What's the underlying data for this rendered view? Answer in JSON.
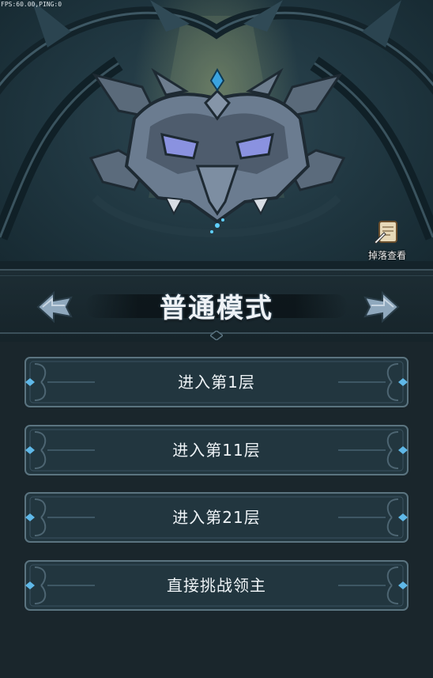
{
  "status": {
    "fps_text": "FPS:60.00,PING:0"
  },
  "hero": {
    "boss_icon": "demon-helmet-icon",
    "drop_view": {
      "label": "掉落查看",
      "icon": "scroll-quill-icon"
    }
  },
  "mode": {
    "title": "普通模式",
    "prev_icon": "arrow-left-icon",
    "next_icon": "arrow-right-icon"
  },
  "buttons": [
    {
      "label": "进入第1层"
    },
    {
      "label": "进入第11层"
    },
    {
      "label": "进入第21层"
    },
    {
      "label": "直接挑战领主"
    }
  ],
  "colors": {
    "accent_blue": "#5fb8e8",
    "panel": "#223640",
    "background": "#1a262c"
  }
}
